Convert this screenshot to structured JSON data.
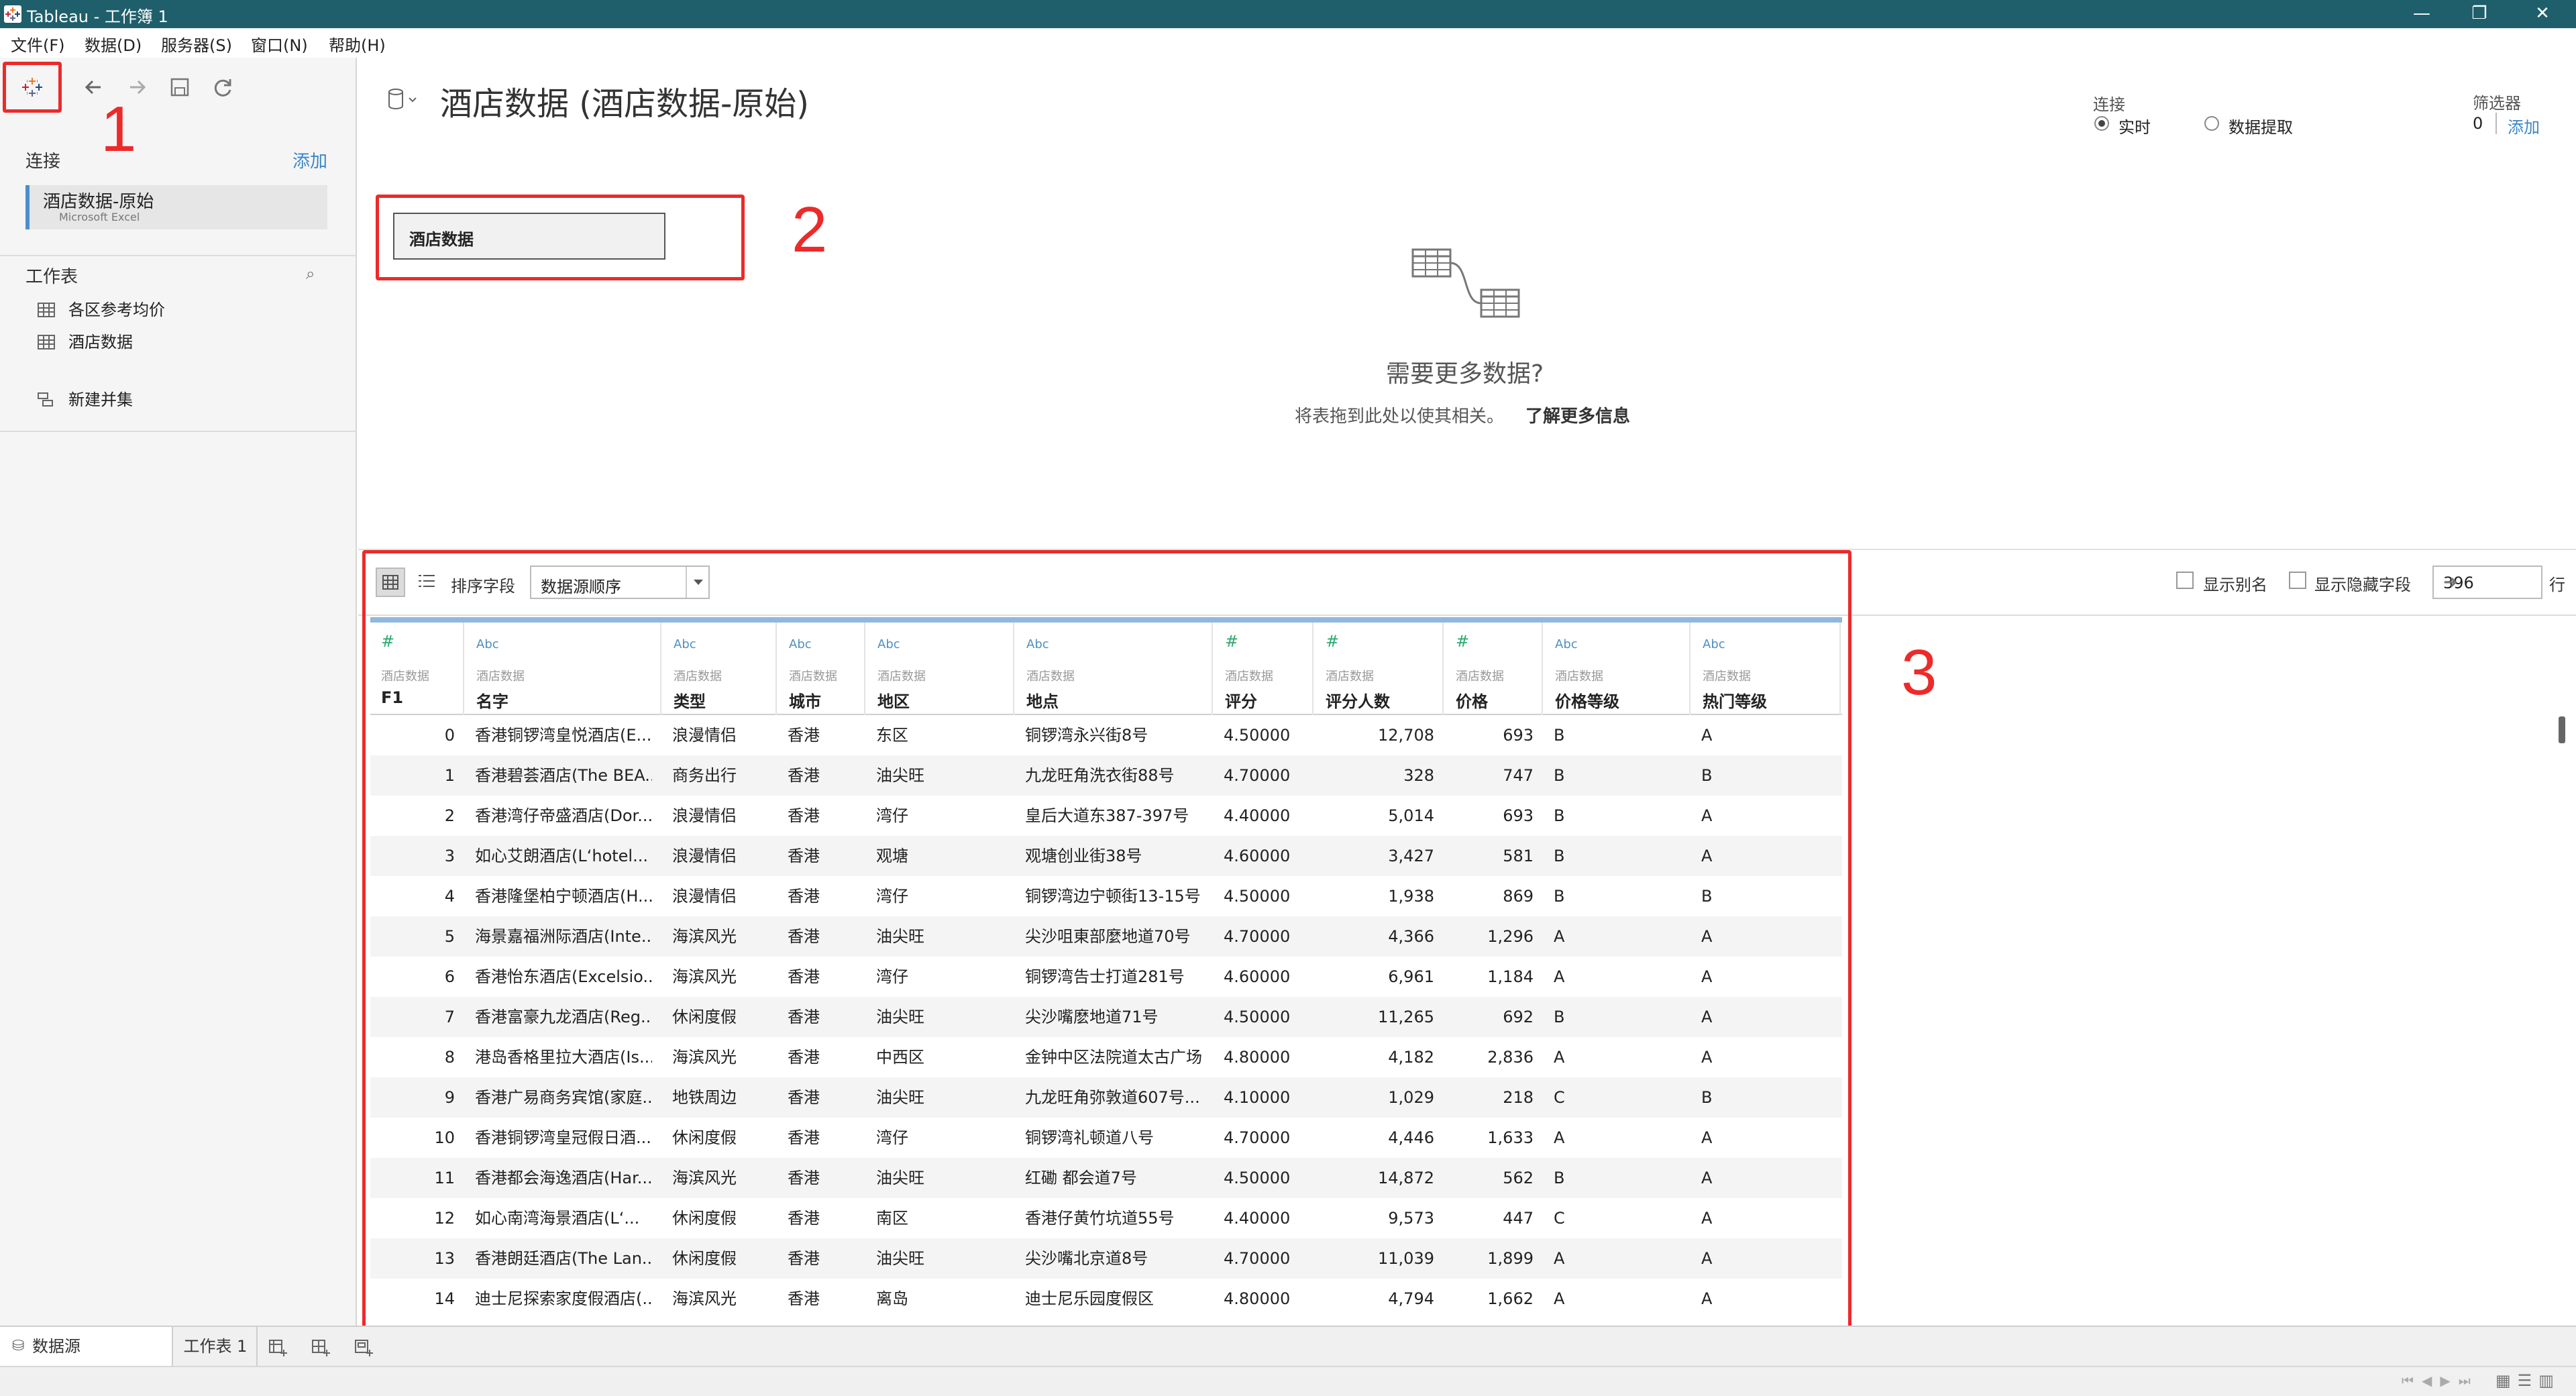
{
  "window": {
    "title": "Tableau - 工作簿 1",
    "minimize": "—",
    "restore": "❐",
    "close": "✕"
  },
  "menu": [
    "文件(F)",
    "数据(D)",
    "服务器(S)",
    "窗口(N)",
    "帮助(H)"
  ],
  "left": {
    "connections_label": "连接",
    "add_label": "添加",
    "connection": {
      "name": "酒店数据-原始",
      "type": "Microsoft Excel"
    },
    "sheets_label": "工作表",
    "sheets": [
      "各区参考均价",
      "酒店数据"
    ],
    "union_label": "新建并集"
  },
  "canvas": {
    "title": "酒店数据 (酒店数据-原始)",
    "connection_label": "连接",
    "live_label": "实时",
    "extract_label": "数据提取",
    "filter_label": "筛选器",
    "filter_count": "0",
    "filter_add": "添加",
    "table_name": "酒店数据",
    "need_more": "需要更多数据?",
    "drag_hint": "将表拖到此处以使其相关。",
    "learn_more": "了解更多信息"
  },
  "annotations": [
    "1",
    "2",
    "3"
  ],
  "grid_toolbar": {
    "sort_label": "排序字段",
    "sort_value": "数据源顺序",
    "show_alias": "显示别名",
    "show_hidden": "显示隐藏字段",
    "rows_value": "396",
    "rows_label": "行"
  },
  "columns": [
    {
      "type": "#",
      "source": "酒店数据",
      "name": "F1"
    },
    {
      "type": "Abc",
      "source": "酒店数据",
      "name": "名字"
    },
    {
      "type": "Abc",
      "source": "酒店数据",
      "name": "类型"
    },
    {
      "type": "Abc",
      "source": "酒店数据",
      "name": "城市"
    },
    {
      "type": "Abc",
      "source": "酒店数据",
      "name": "地区"
    },
    {
      "type": "Abc",
      "source": "酒店数据",
      "name": "地点"
    },
    {
      "type": "#",
      "source": "酒店数据",
      "name": "评分"
    },
    {
      "type": "#",
      "source": "酒店数据",
      "name": "评分人数"
    },
    {
      "type": "#",
      "source": "酒店数据",
      "name": "价格"
    },
    {
      "type": "Abc",
      "source": "酒店数据",
      "name": "价格等级"
    },
    {
      "type": "Abc",
      "source": "酒店数据",
      "name": "热门等级"
    }
  ],
  "rows": [
    [
      "0",
      "香港铜锣湾皇悦酒店(E...",
      "浪漫情侣",
      "香港",
      "东区",
      "铜锣湾永兴街8号",
      "4.50000",
      "12,708",
      "693",
      "B",
      "A"
    ],
    [
      "1",
      "香港碧荟酒店(The BEA...",
      "商务出行",
      "香港",
      "油尖旺",
      "九龙旺角洗衣街88号",
      "4.70000",
      "328",
      "747",
      "B",
      "B"
    ],
    [
      "2",
      "香港湾仔帝盛酒店(Dor...",
      "浪漫情侣",
      "香港",
      "湾仔",
      "皇后大道东387-397号",
      "4.40000",
      "5,014",
      "693",
      "B",
      "A"
    ],
    [
      "3",
      "如心艾朗酒店(L‘hotel...",
      "浪漫情侣",
      "香港",
      "观塘",
      "观塘创业街38号",
      "4.60000",
      "3,427",
      "581",
      "B",
      "A"
    ],
    [
      "4",
      "香港隆堡柏宁顿酒店(H...",
      "浪漫情侣",
      "香港",
      "湾仔",
      "铜锣湾边宁顿街13-15号",
      "4.50000",
      "1,938",
      "869",
      "B",
      "B"
    ],
    [
      "5",
      "海景嘉福洲际酒店(Inte...",
      "海滨风光",
      "香港",
      "油尖旺",
      "尖沙咀東部麼地道70号",
      "4.70000",
      "4,366",
      "1,296",
      "A",
      "A"
    ],
    [
      "6",
      "香港怡东酒店(Excelsio...",
      "海滨风光",
      "香港",
      "湾仔",
      "铜锣湾告士打道281号",
      "4.60000",
      "6,961",
      "1,184",
      "A",
      "A"
    ],
    [
      "7",
      "香港富豪九龙酒店(Reg...",
      "休闲度假",
      "香港",
      "油尖旺",
      "尖沙嘴麽地道71号",
      "4.50000",
      "11,265",
      "692",
      "B",
      "A"
    ],
    [
      "8",
      "港岛香格里拉大酒店(Is...",
      "海滨风光",
      "香港",
      "中西区",
      "金钟中区法院道太古广场",
      "4.80000",
      "4,182",
      "2,836",
      "A",
      "A"
    ],
    [
      "9",
      "香港广易商务宾馆(家庭...",
      "地铁周边",
      "香港",
      "油尖旺",
      "九龙旺角弥敦道607号...",
      "4.10000",
      "1,029",
      "218",
      "C",
      "B"
    ],
    [
      "10",
      "香港铜锣湾皇冠假日酒...",
      "休闲度假",
      "香港",
      "湾仔",
      "铜锣湾礼顿道八号",
      "4.70000",
      "4,446",
      "1,633",
      "A",
      "A"
    ],
    [
      "11",
      "香港都会海逸酒店(Har...",
      "海滨风光",
      "香港",
      "油尖旺",
      "红磡 都会道7号",
      "4.50000",
      "14,872",
      "562",
      "B",
      "A"
    ],
    [
      "12",
      "如心南湾海景酒店(L‘...",
      "休闲度假",
      "香港",
      "南区",
      "香港仔黄竹坑道55号",
      "4.40000",
      "9,573",
      "447",
      "C",
      "A"
    ],
    [
      "13",
      "香港朗廷酒店(The Lan...",
      "休闲度假",
      "香港",
      "油尖旺",
      "尖沙嘴北京道8号",
      "4.70000",
      "11,039",
      "1,899",
      "A",
      "A"
    ],
    [
      "14",
      "迪士尼探索家度假酒店(...",
      "海滨风光",
      "香港",
      "离岛",
      "迪士尼乐园度假区",
      "4.80000",
      "4,794",
      "1,662",
      "A",
      "A"
    ]
  ],
  "bottom_tabs": {
    "datasource": "数据源",
    "worksheet": "工作表 1"
  }
}
